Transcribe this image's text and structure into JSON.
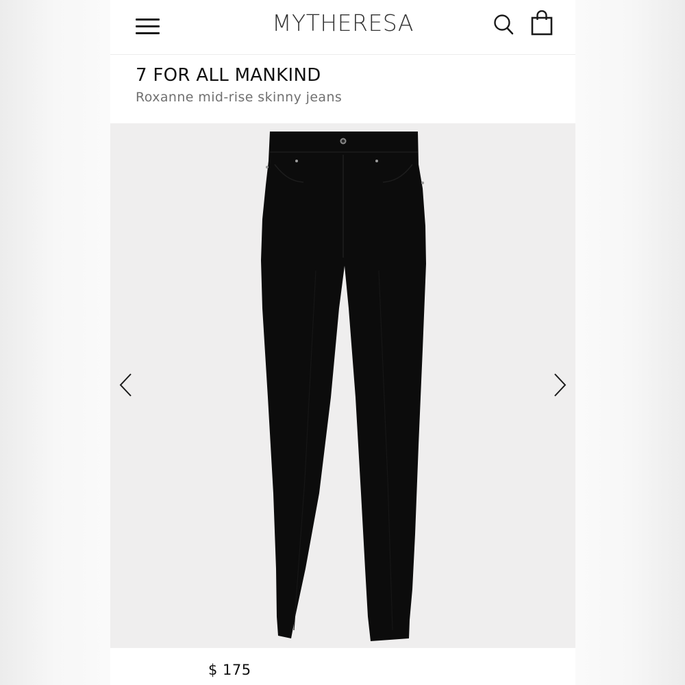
{
  "header": {
    "logo_text": "MYTHERESA",
    "menu_icon": "hamburger-menu-icon",
    "search_icon": "search-icon",
    "bag_icon": "shopping-bag-icon"
  },
  "product": {
    "brand": "7 FOR ALL MANKIND",
    "name": "Roxanne mid-rise skinny jeans",
    "price": "$ 175"
  },
  "gallery": {
    "prev_icon": "chevron-left-icon",
    "next_icon": "chevron-right-icon",
    "image_color": "#0c0c0c",
    "background_color": "#efeeee"
  }
}
